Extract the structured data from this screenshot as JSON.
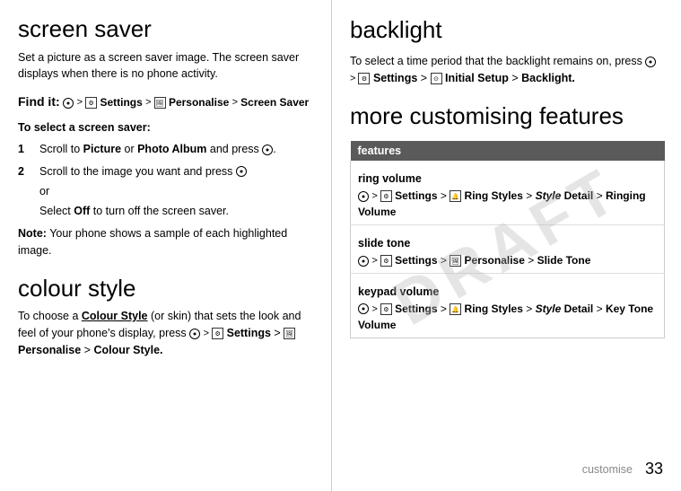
{
  "left": {
    "screen_saver_title": "screen saver",
    "intro": "Set a picture as a screen saver image. The screen saver displays when there is no phone activity.",
    "find_it_label": "Find it:",
    "find_it_path": " > Settings >  Personalise > Screen Saver",
    "select_heading": "To select a screen saver:",
    "steps": [
      {
        "num": "1",
        "text": "Scroll to Picture or Photo Album and press"
      },
      {
        "num": "2",
        "text": "Scroll to the image you want and press"
      }
    ],
    "or_label": "or",
    "select_off": "Select Off to turn off the screen saver.",
    "note_label": "Note:",
    "note_text": " Your phone shows a sample of each highlighted image.",
    "colour_style_title": "colour style",
    "colour_intro_1": "To choose a ",
    "colour_style_link": "Colour Style",
    "colour_intro_2": " (or skin) that sets the look and feel of your phone's display, press ",
    "colour_path": " >  Settings >  Personalise > Colour Style."
  },
  "right": {
    "backlight_title": "backlight",
    "backlight_intro": "To select a time period that the backlight remains on, press",
    "backlight_path": " > Settings >  Initial Setup > Backlight.",
    "more_features_title": "more customising features",
    "table_header": "features",
    "rows": [
      {
        "name": "ring volume",
        "path": " >  Settings >  Ring Styles > Style Detail > Ringing Volume"
      },
      {
        "name": "slide tone",
        "path": " >  Settings >  Personalise > Slide Tone"
      },
      {
        "name": "keypad volume",
        "path": " >  Settings >  Ring Styles > Style Detail > Key Tone Volume"
      }
    ],
    "footer_word": "customise",
    "footer_page": "33"
  }
}
